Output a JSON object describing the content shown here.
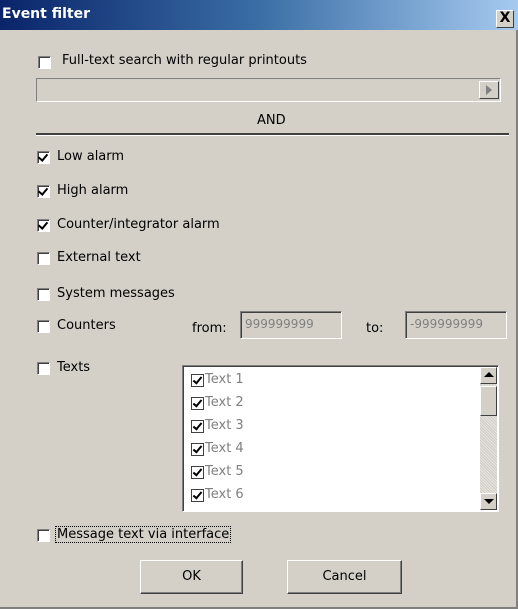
{
  "window": {
    "title": "Event filter",
    "close_glyph": "X"
  },
  "fulltext": {
    "label": "Full-text search with regular printouts",
    "checked": false,
    "value": ""
  },
  "operator_label": "AND",
  "checkboxes": [
    {
      "label": "Low alarm",
      "checked": true
    },
    {
      "label": "High alarm",
      "checked": true
    },
    {
      "label": "Counter/integrator alarm",
      "checked": true
    },
    {
      "label": "External text",
      "checked": false
    },
    {
      "label": "System messages",
      "checked": false
    },
    {
      "label": "Counters",
      "checked": false
    },
    {
      "label": "Texts",
      "checked": false
    }
  ],
  "counters": {
    "from_label": "from:",
    "from_value": "999999999",
    "to_label": "to:",
    "to_value": "-999999999"
  },
  "texts_list": [
    {
      "label": "Text 1",
      "checked": true
    },
    {
      "label": "Text 2",
      "checked": true
    },
    {
      "label": "Text 3",
      "checked": true
    },
    {
      "label": "Text 4",
      "checked": true
    },
    {
      "label": "Text 5",
      "checked": true
    },
    {
      "label": "Text 6",
      "checked": true
    }
  ],
  "message_text": {
    "label": "Message text via interface",
    "checked": false
  },
  "buttons": {
    "ok": "OK",
    "cancel": "Cancel"
  }
}
